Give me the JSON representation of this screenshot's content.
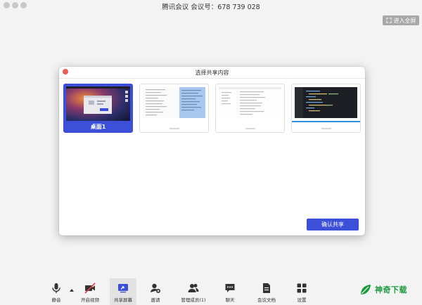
{
  "window": {
    "title": "腾讯会议 会议号：678 739 028"
  },
  "fullscreen": {
    "label": "进入全屏",
    "icon": "expand-icon"
  },
  "modal": {
    "title": "选择共享内容",
    "options": [
      {
        "label": "桌面1",
        "selected": true
      },
      {
        "label": "",
        "selected": false
      },
      {
        "label": "",
        "selected": false
      },
      {
        "label": "",
        "selected": false
      }
    ],
    "confirm_label": "确认共享"
  },
  "toolbar": {
    "items": [
      {
        "label": "静音",
        "icon": "microphone-icon"
      },
      {
        "label": "开启视频",
        "icon": "video-off-icon"
      },
      {
        "label": "共享屏幕",
        "icon": "share-screen-icon",
        "active": true
      },
      {
        "label": "邀请",
        "icon": "invite-user-icon"
      },
      {
        "label": "管理成员(1)",
        "icon": "members-icon"
      },
      {
        "label": "聊天",
        "icon": "chat-icon"
      },
      {
        "label": "会议文档",
        "icon": "document-icon"
      },
      {
        "label": "设置",
        "icon": "settings-grid-icon"
      }
    ]
  },
  "watermark": {
    "text": "神奇下载"
  },
  "colors": {
    "accent": "#3b4fd8",
    "close": "#ec5b55",
    "watermark": "#1a9a3c"
  }
}
